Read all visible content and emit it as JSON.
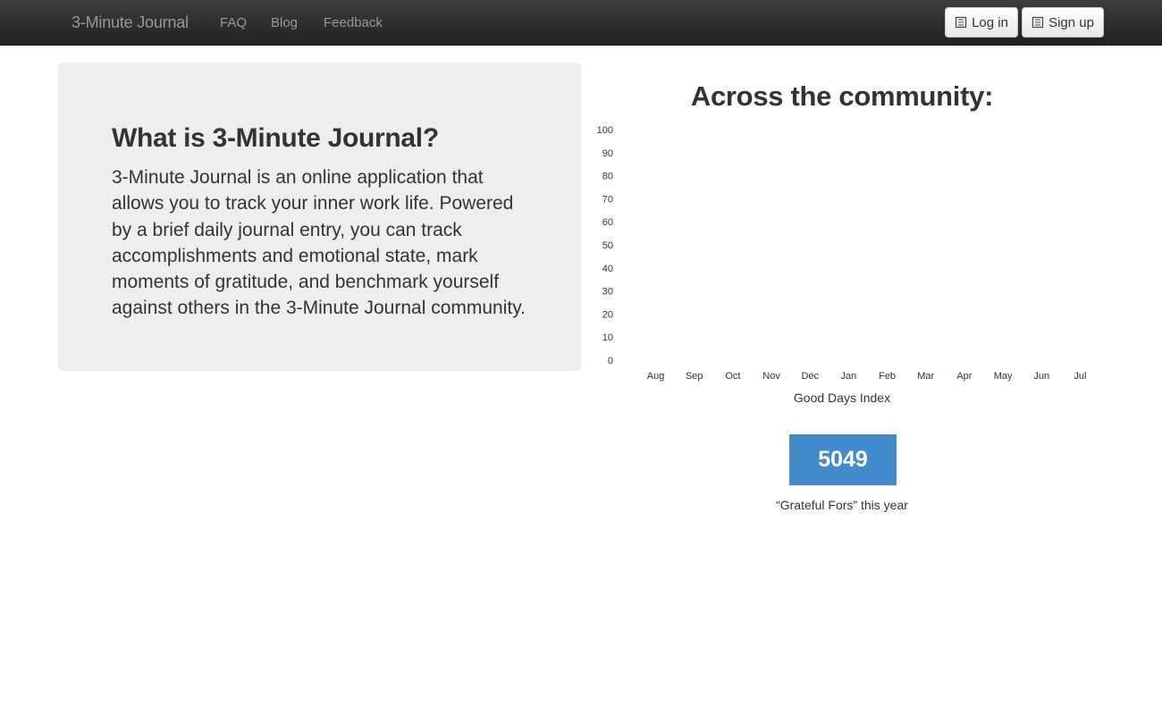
{
  "navbar": {
    "brand": "3-Minute Journal",
    "links": [
      {
        "label": "FAQ"
      },
      {
        "label": "Blog"
      },
      {
        "label": "Feedback"
      }
    ],
    "login_label": "Log in",
    "signup_label": "Sign up",
    "login_icon": "sign-in-icon",
    "signup_icon": "sign-up-icon"
  },
  "hero": {
    "title": "What is 3-Minute Journal?",
    "text": "3-Minute Journal is an online application that allows you to track your inner work life. Powered by a brief daily journal entry, you can track accomplishments and emotional state, mark moments of gratitude, and benchmark yourself against others in the 3-Minute Journal community."
  },
  "community": {
    "title": "Across the community:",
    "chart_label": "Good Days Index",
    "stat_value": "5049",
    "stat_caption": "“Grateful Fors” this year",
    "stat_color": "#428bca"
  },
  "chart_data": {
    "type": "bar",
    "categories": [
      "Aug",
      "Sep",
      "Oct",
      "Nov",
      "Dec",
      "Jan",
      "Feb",
      "Mar",
      "Apr",
      "May",
      "Jun",
      "Jul"
    ],
    "values": [],
    "yticks": [
      "0",
      "10",
      "20",
      "30",
      "40",
      "50",
      "60",
      "70",
      "80",
      "90",
      "100"
    ],
    "ylim": [
      0,
      100
    ],
    "xlabel": "Good Days Index",
    "ylabel": "",
    "title": ""
  }
}
